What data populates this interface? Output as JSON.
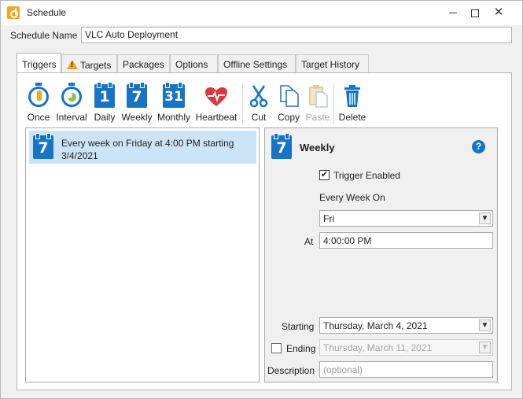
{
  "window": {
    "title": "Schedule",
    "controls": [
      "minimize",
      "maximize",
      "close"
    ]
  },
  "schedule": {
    "name_label": "Schedule Name",
    "name_value": "VLC Auto Deployment"
  },
  "tabs": [
    {
      "label": "Triggers",
      "active": true
    },
    {
      "label": "Targets",
      "warning": true
    },
    {
      "label": "Packages"
    },
    {
      "label": "Options"
    },
    {
      "label": "Offline Settings"
    },
    {
      "label": "Target History"
    }
  ],
  "toolbar": {
    "once": "Once",
    "interval": "Interval",
    "daily": "Daily",
    "daily_num": "1",
    "weekly": "Weekly",
    "weekly_num": "7",
    "monthly": "Monthly",
    "monthly_num": "31",
    "heartbeat": "Heartbeat",
    "cut": "Cut",
    "copy": "Copy",
    "paste": "Paste",
    "delete": "Delete"
  },
  "triggers": [
    {
      "icon_num": "7",
      "text": "Every week on Friday at 4:00 PM starting 3/4/2021",
      "selected": true
    }
  ],
  "details": {
    "icon_num": "7",
    "title": "Weekly",
    "help": "?",
    "trigger_enabled_label": "Trigger Enabled",
    "trigger_enabled": true,
    "every_week_on_label": "Every Week On",
    "day_value": "Fri",
    "at_label": "At",
    "at_value": "4:00:00 PM",
    "starting_label": "Starting",
    "starting_value": "Thursday, March 4, 2021",
    "ending_label": "Ending",
    "ending_enabled": false,
    "ending_value": "Thursday, March 11, 2021",
    "description_label": "Description",
    "description_placeholder": "(optional)"
  },
  "colors": {
    "accent_blue": "#1673c8",
    "selection": "#cce4f7",
    "warning": "#f0a30a",
    "heart_red": "#d9363e"
  }
}
